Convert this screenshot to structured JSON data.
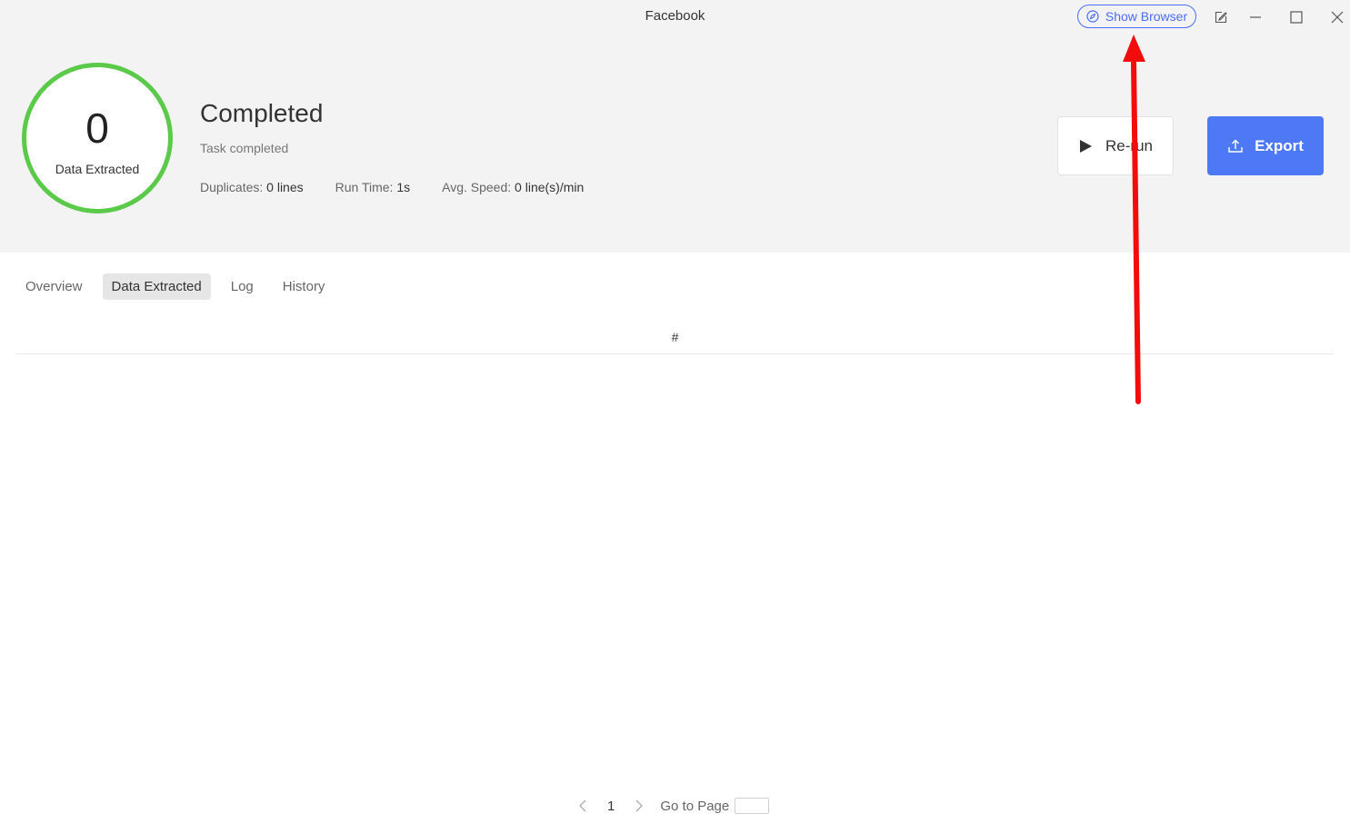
{
  "window": {
    "title": "Facebook",
    "show_browser_label": "Show Browser"
  },
  "summary": {
    "count": "0",
    "count_label": "Data Extracted",
    "status_title": "Completed",
    "status_subtitle": "Task completed",
    "stats": [
      {
        "label": "Duplicates:",
        "value": "0 lines"
      },
      {
        "label": "Run Time:",
        "value": "1s"
      },
      {
        "label": "Avg. Speed:",
        "value": "0 line(s)/min"
      }
    ],
    "ring_color": "#5bc94a"
  },
  "actions": {
    "rerun_label": "Re-run",
    "export_label": "Export",
    "export_color": "#4d79f6"
  },
  "tabs": [
    {
      "label": "Overview",
      "active": false
    },
    {
      "label": "Data Extracted",
      "active": true
    },
    {
      "label": "Log",
      "active": false
    },
    {
      "label": "History",
      "active": false
    }
  ],
  "table": {
    "columns": [
      "#"
    ]
  },
  "pagination": {
    "current_page": "1",
    "goto_label": "Go to Page"
  },
  "annotation": {
    "arrow_color": "#f20c0c"
  }
}
